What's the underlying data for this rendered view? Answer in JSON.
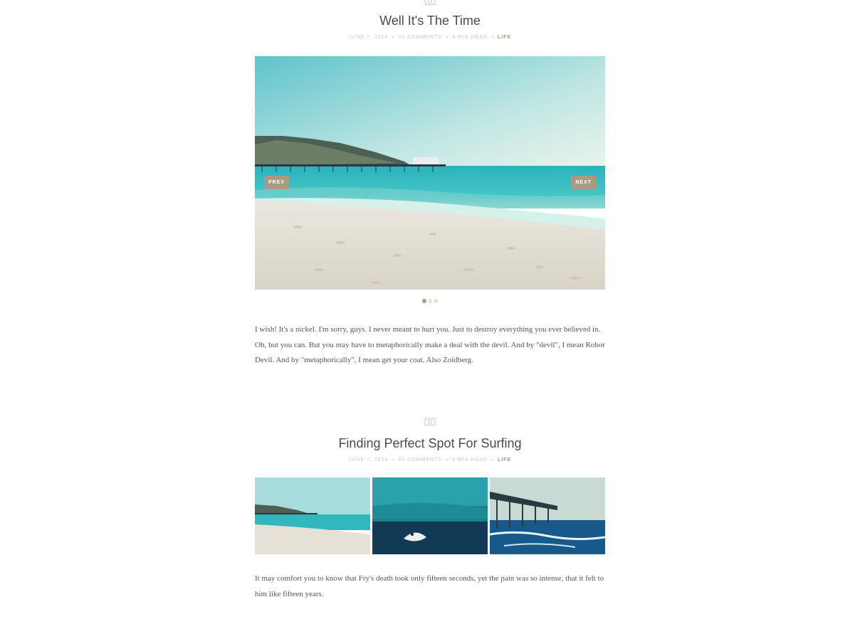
{
  "posts": [
    {
      "icon": "camera-icon",
      "title": "Well It's The Time",
      "date": "June 7, 2014",
      "comments": "34 Comments",
      "read": "3 min read",
      "category": "Life",
      "slider": {
        "prev_label": "PREV",
        "next_label": "NEXT",
        "slides": 3,
        "active": 1
      },
      "excerpt": "I wish! It's a nickel. I'm sorry, guys. I never meant to hurt you. Just to destroy everything you ever believed in. Oh, but you can. But you may have to metaphorically make a deal with the devil. And by \"devil\", I mean Robot Devil. And by \"metaphorically\", I mean get your coat. Also Zoidberg."
    },
    {
      "icon": "camera-icon",
      "title": "Finding Perfect Spot For Surfing",
      "date": "June 7, 2014",
      "comments": "63 Comments",
      "read": "3 min read",
      "category": "Life",
      "excerpt": "It may comfort you to know that Fry's death took only fifteen seconds, yet the pain was so intense, that it felt to him like fifteen years."
    }
  ],
  "colors": {
    "accent": "#a99a82",
    "meta": "#cbc6bd",
    "title": "#4a4a4a",
    "text": "#555555"
  }
}
